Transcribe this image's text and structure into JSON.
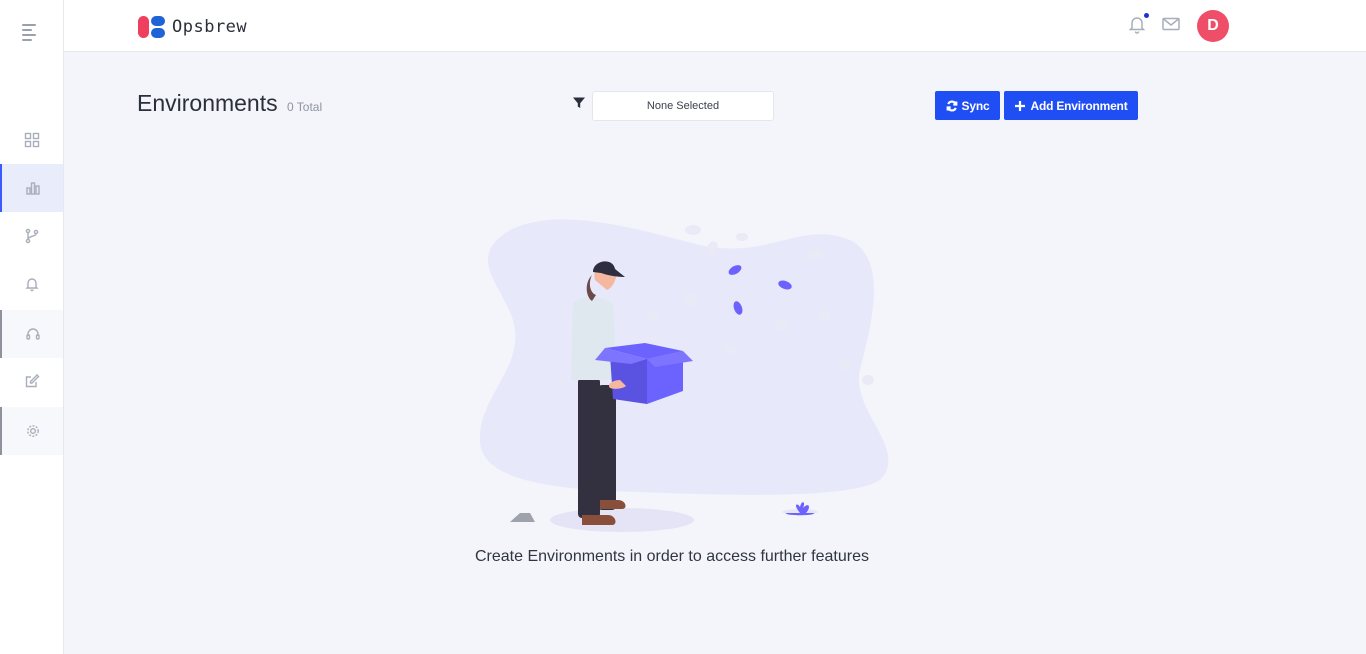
{
  "app": {
    "name": "Opsbrew"
  },
  "header": {
    "avatar_initial": "D",
    "notification_icon": "bell-icon",
    "mail_icon": "mail-icon"
  },
  "sidebar": {
    "items": [
      {
        "icon": "grid-icon",
        "active": false
      },
      {
        "icon": "bar-chart-icon",
        "active": true
      },
      {
        "icon": "git-branch-icon",
        "active": false
      },
      {
        "icon": "bell-icon",
        "active": false
      },
      {
        "icon": "headset-icon",
        "active": false
      },
      {
        "icon": "edit-icon",
        "active": false
      },
      {
        "icon": "settings-icon",
        "active": false
      }
    ]
  },
  "page": {
    "title": "Environments",
    "total": "0 Total",
    "filter": {
      "selected": "None Selected"
    },
    "buttons": {
      "sync": "Sync",
      "add": "Add Environment"
    },
    "empty_message": "Create Environments in order to access further features"
  },
  "colors": {
    "accent": "#1f4ef5",
    "avatar": "#ef4e68",
    "logo_red": "#ef3f5f",
    "logo_blue": "#1f63d6",
    "illustration": "#6c63ff"
  }
}
